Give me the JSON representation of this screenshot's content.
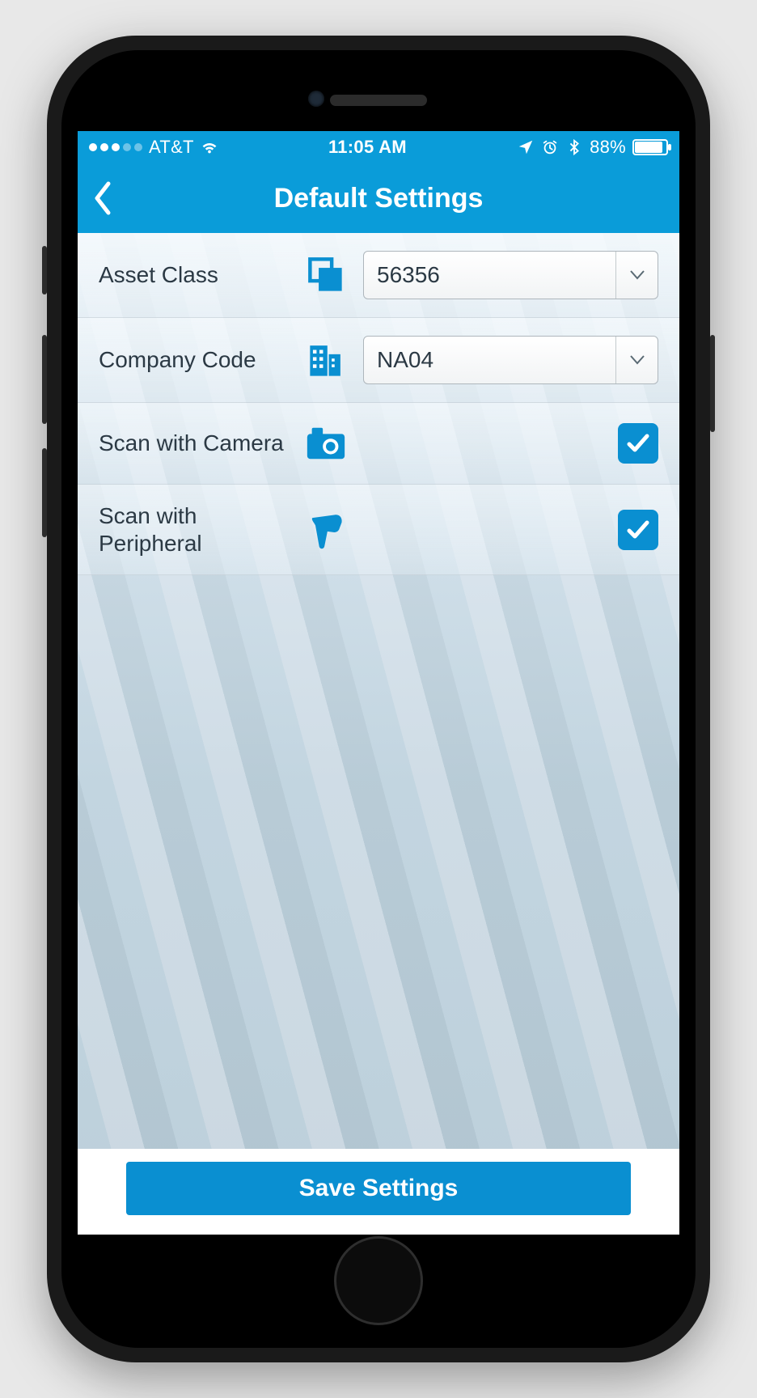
{
  "statusbar": {
    "carrier": "AT&T",
    "time": "11:05 AM",
    "battery_pct": "88%"
  },
  "navbar": {
    "title": "Default Settings"
  },
  "rows": {
    "asset_class": {
      "label": "Asset Class",
      "value": "56356"
    },
    "company_code": {
      "label": "Company Code",
      "value": "NA04"
    },
    "scan_camera": {
      "label": "Scan with Camera",
      "checked": true
    },
    "scan_peripheral": {
      "label": "Scan with Peripheral",
      "checked": true
    }
  },
  "footer": {
    "save_label": "Save Settings"
  }
}
